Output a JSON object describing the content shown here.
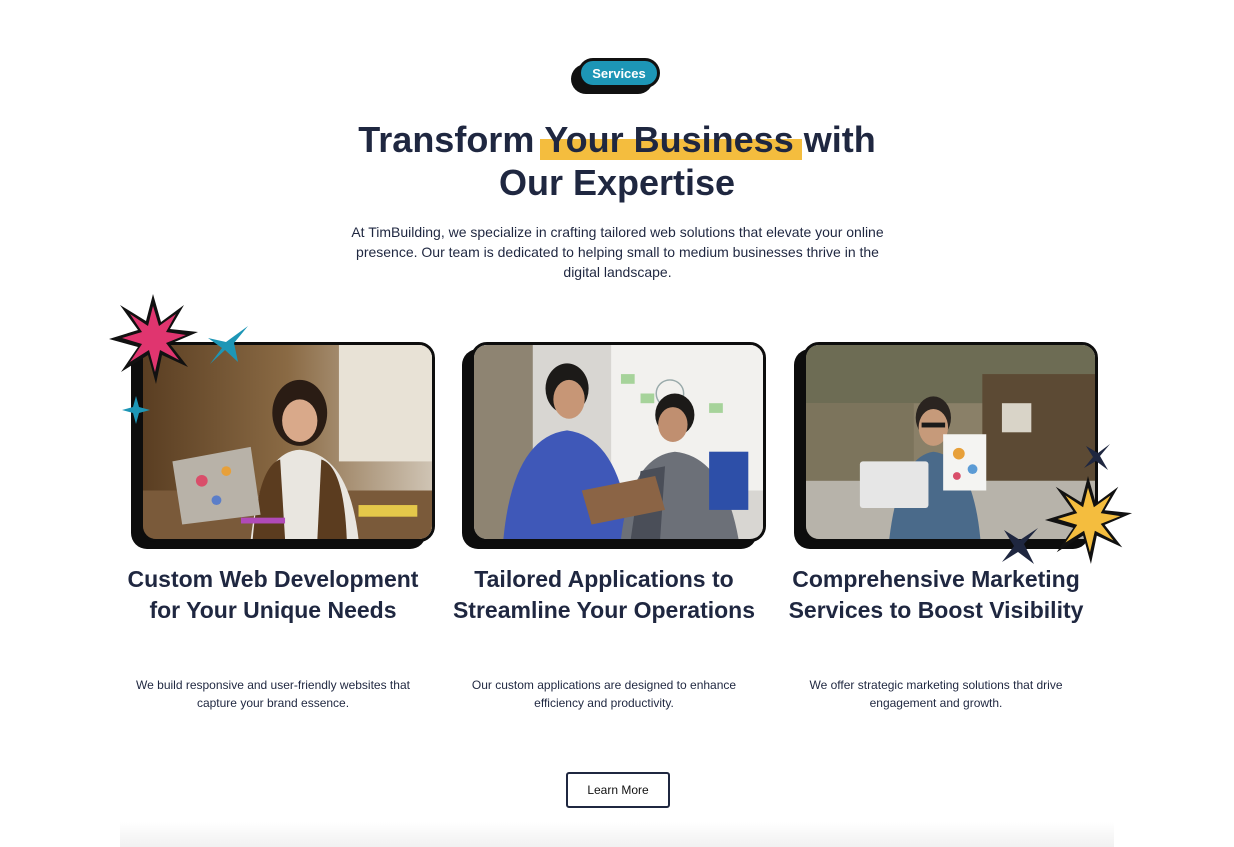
{
  "badge": {
    "label": "Services"
  },
  "headline": {
    "before": "Transform ",
    "highlight": "Your Business",
    "after": " with",
    "line2": "Our Expertise"
  },
  "intro": "At TimBuilding, we specialize in crafting tailored web solutions that elevate your online presence. Our team is dedicated to helping small to medium businesses thrive in the digital landscape.",
  "cards": [
    {
      "title": "Custom Web Development for Your Unique Needs",
      "text": "We build responsive and user-friendly websites that capture your brand essence."
    },
    {
      "title": "Tailored Applications to Streamline Your Operations",
      "text": "Our custom applications are designed to enhance efficiency and productivity."
    },
    {
      "title": "Comprehensive Marketing Services to Boost Visibility",
      "text": "We offer strategic marketing solutions that drive engagement and growth."
    }
  ],
  "cta": {
    "label": "Learn More"
  },
  "colors": {
    "accent_teal": "#1d96b6",
    "highlight_yellow": "#f4bd3e",
    "burst_pink": "#e0356f",
    "text_navy": "#1f2740"
  }
}
